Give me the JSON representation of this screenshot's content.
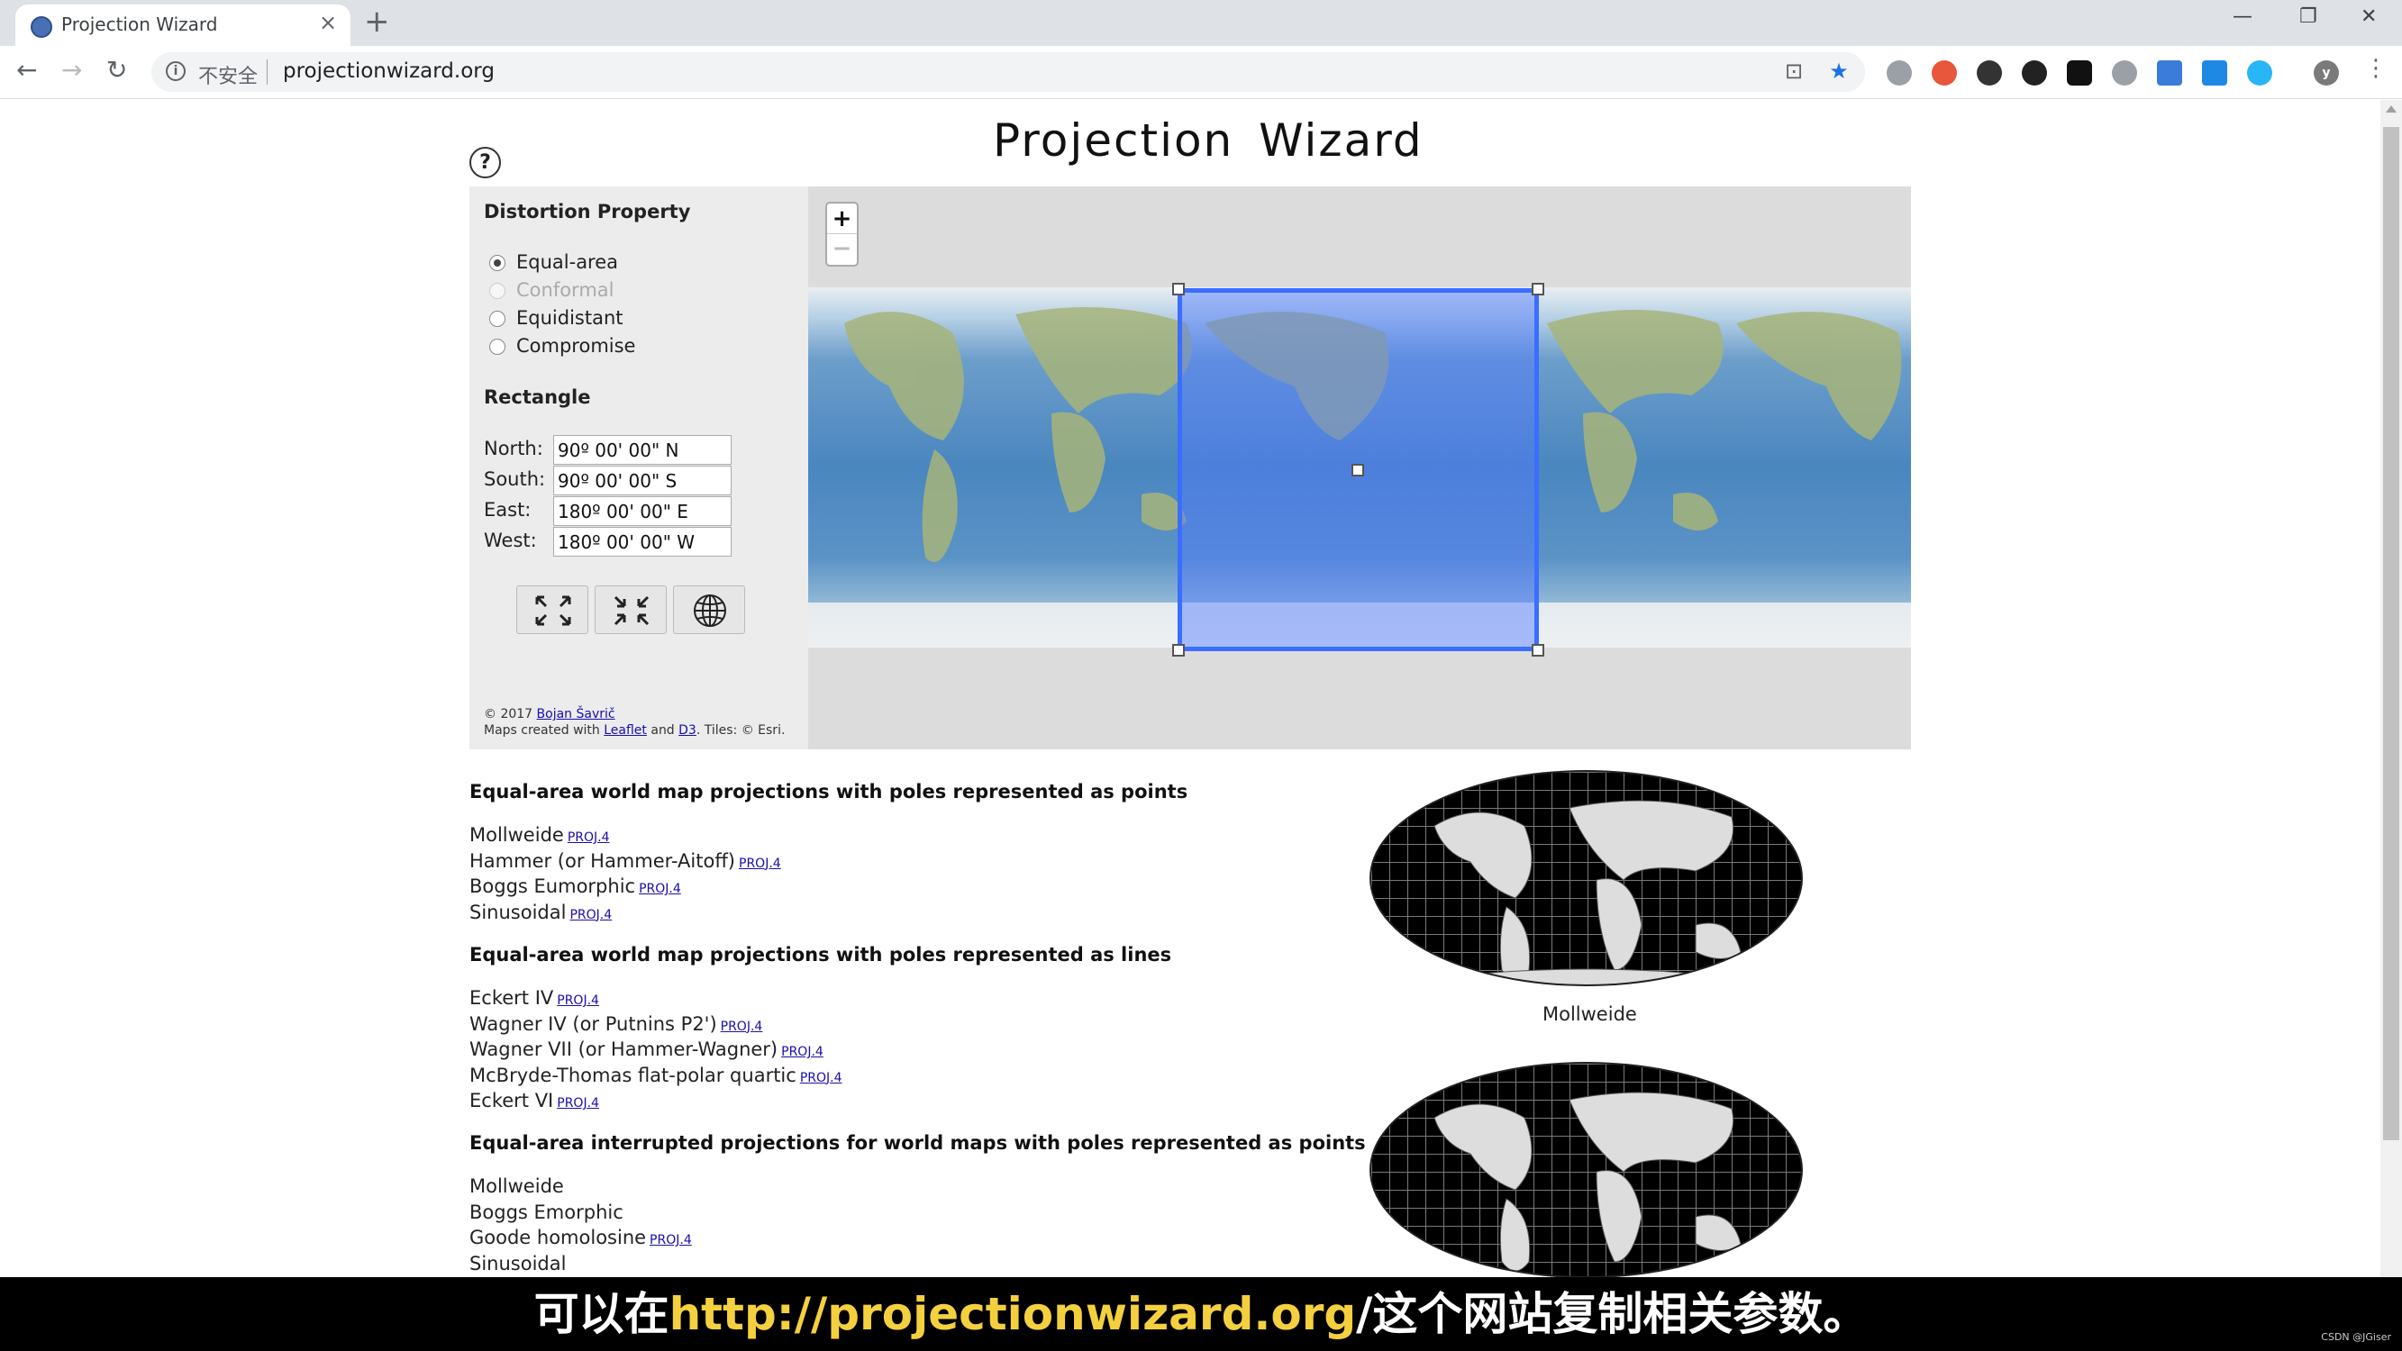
{
  "browser": {
    "tab_title": "Projection Wizard",
    "insecure_label": "不安全",
    "url": "projectionwizard.org"
  },
  "page": {
    "title": "Projection  Wizard",
    "help": "?",
    "distortion_heading": "Distortion Property",
    "distortion_options": [
      {
        "label": "Equal-area",
        "checked": true,
        "disabled": false
      },
      {
        "label": "Conformal",
        "checked": false,
        "disabled": true
      },
      {
        "label": "Equidistant",
        "checked": false,
        "disabled": false
      },
      {
        "label": "Compromise",
        "checked": false,
        "disabled": false
      }
    ],
    "rectangle_heading": "Rectangle",
    "coords": [
      {
        "label": "North:",
        "value": "90º 00' 00\" N"
      },
      {
        "label": "South:",
        "value": "90º 00' 00\" S"
      },
      {
        "label": "East:",
        "value": "180º 00' 00\" E"
      },
      {
        "label": "West:",
        "value": "180º 00' 00\" W"
      }
    ],
    "credits_year": "© 2017",
    "credits_author": "Bojan Šavrič",
    "credits_maps_prefix": "Maps created with",
    "credits_leaflet": "Leaflet",
    "credits_and": "and",
    "credits_d3": "D3",
    "credits_tiles": ". Tiles: © Esri.",
    "zoom_in": "+",
    "zoom_out": "−"
  },
  "results": {
    "proj_link": "PROJ.4",
    "section1_heading": "Equal-area world map projections with poles represented as points",
    "section1_items": [
      {
        "name": "Mollweide",
        "link": true
      },
      {
        "name": "Hammer (or Hammer-Aitoff)",
        "link": true
      },
      {
        "name": "Boggs Eumorphic",
        "link": true
      },
      {
        "name": "Sinusoidal",
        "link": true
      }
    ],
    "section2_heading": "Equal-area world map projections with poles represented as lines",
    "section2_items": [
      {
        "name": "Eckert IV",
        "link": true
      },
      {
        "name": "Wagner IV (or Putnins P2')",
        "link": true
      },
      {
        "name": "Wagner VII (or Hammer-Wagner)",
        "link": true
      },
      {
        "name": "McBryde-Thomas flat-polar quartic",
        "link": true
      },
      {
        "name": "Eckert VI",
        "link": true
      }
    ],
    "section3_heading": "Equal-area interrupted projections for world maps with poles represented as points",
    "section3_items": [
      {
        "name": "Mollweide",
        "link": false
      },
      {
        "name": "Boggs Emorphic",
        "link": false
      },
      {
        "name": "Goode homolosine",
        "link": true
      },
      {
        "name": "Sinusoidal",
        "link": false
      }
    ],
    "preview_caption": "Mollweide"
  },
  "subtitle": {
    "before": "可以在",
    "highlight": "http://projectionwizard.org",
    "after": "/这个网站复制相关参数。"
  },
  "watermark": "CSDN @JGiser",
  "colors": {
    "selection": "#3b6dff",
    "link": "#1a0dab",
    "subtitle_highlight": "#f4d03f"
  }
}
